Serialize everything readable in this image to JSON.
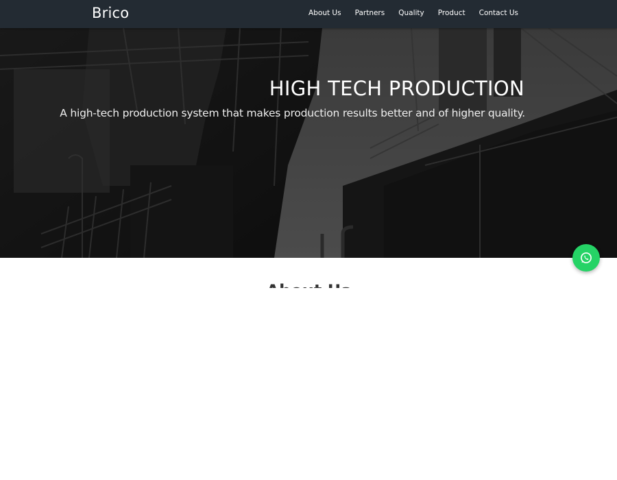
{
  "navbar": {
    "brand": "Brico",
    "links": [
      "About Us",
      "Partners",
      "Quality",
      "Product",
      "Contact Us"
    ]
  },
  "hero": {
    "title": "HIGH TECH PRODUCTION",
    "subtitle": "A high-tech production system that makes production results better and of higher quality.",
    "background_icon": "industrial-plant-photo"
  },
  "about": {
    "heading": "About Us"
  },
  "whatsapp": {
    "icon": "whatsapp-icon",
    "color": "#25d366"
  },
  "colors": {
    "navbar": "#232b33",
    "hero_overlay": "#000000"
  }
}
